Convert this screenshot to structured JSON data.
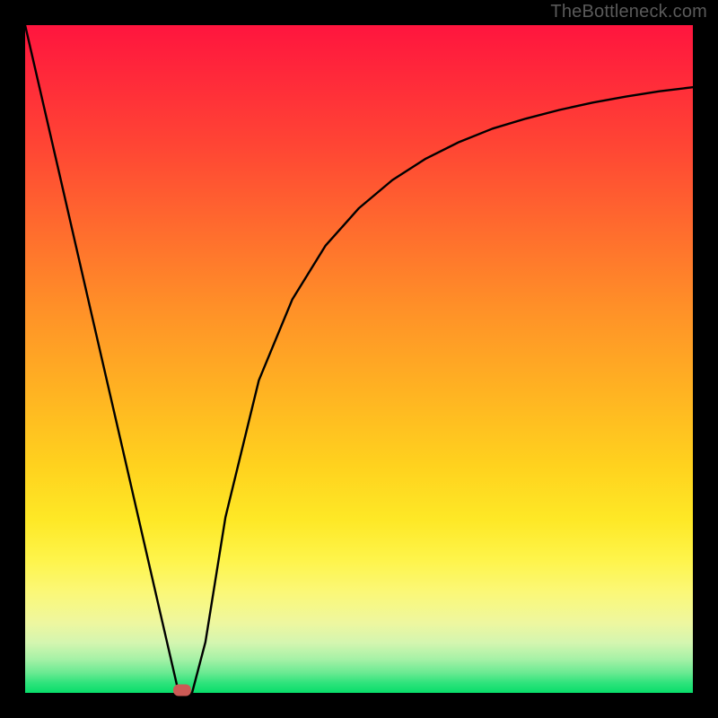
{
  "watermark": "TheBottleneck.com",
  "chart_data": {
    "type": "line",
    "title": "",
    "xlabel": "",
    "ylabel": "",
    "xlim": [
      0,
      100
    ],
    "ylim": [
      0,
      100
    ],
    "grid": false,
    "legend": false,
    "background": "vertical-heatmap-gradient",
    "x": [
      0,
      5,
      10,
      15,
      20,
      23,
      25,
      27,
      30,
      35,
      40,
      45,
      50,
      55,
      60,
      65,
      70,
      75,
      80,
      85,
      90,
      95,
      100
    ],
    "values": [
      100,
      78.3,
      56.5,
      34.8,
      13.0,
      0,
      0,
      7.6,
      26.3,
      46.8,
      58.9,
      67.0,
      72.6,
      76.8,
      80.0,
      82.5,
      84.5,
      86.0,
      87.3,
      88.4,
      89.3,
      90.1,
      90.7
    ],
    "marker": {
      "x": 23.5,
      "y": 0
    },
    "gradient_stops": [
      {
        "pos": 0,
        "color": "#ff153e"
      },
      {
        "pos": 50,
        "color": "#ffa525"
      },
      {
        "pos": 80,
        "color": "#fef44a"
      },
      {
        "pos": 100,
        "color": "#08dd6a"
      }
    ]
  }
}
